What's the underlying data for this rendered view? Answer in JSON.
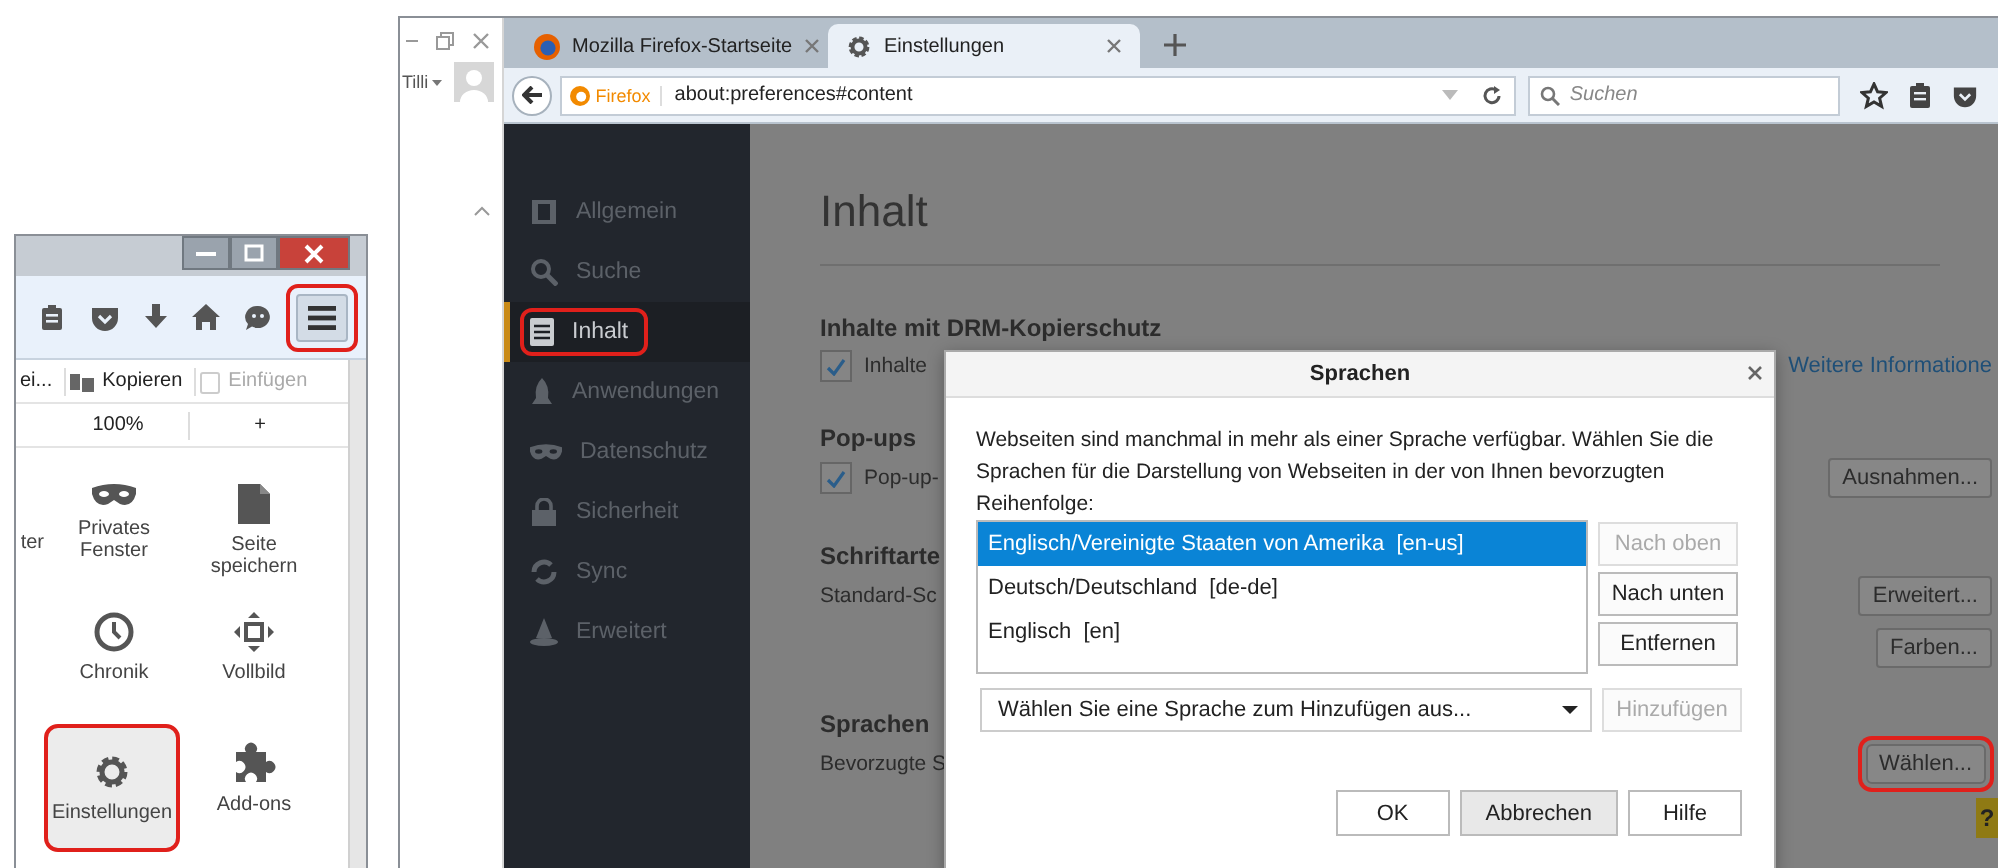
{
  "left_window": {
    "toolbar_icons": [
      {
        "kind": "clipboard",
        "highlighted": false
      },
      {
        "kind": "pocket",
        "highlighted": false
      },
      {
        "kind": "download",
        "highlighted": false
      },
      {
        "kind": "home",
        "highlighted": false
      },
      {
        "kind": "chat",
        "highlighted": false
      },
      {
        "kind": "menu",
        "highlighted": true
      }
    ],
    "edit_row": [
      {
        "label": "ei...",
        "kind": "cut",
        "disabled": false
      },
      {
        "label": "Kopieren",
        "kind": "copy",
        "disabled": false
      },
      {
        "label": "Einfügen",
        "kind": "paste",
        "disabled": true
      }
    ],
    "zoom_row": {
      "value": "100%",
      "increase": "+"
    },
    "menu_items": [
      {
        "label": "ter",
        "kind": "partial",
        "highlighted": false
      },
      {
        "label": "Privates Fenster",
        "kind": "mask",
        "highlighted": false
      },
      {
        "label": "Seite speichern",
        "kind": "page",
        "highlighted": false
      },
      {
        "label": "Chronik",
        "kind": "clock",
        "highlighted": false
      },
      {
        "label": "Vollbild",
        "kind": "fullscreen",
        "highlighted": false
      },
      {
        "label": "Einstellungen",
        "kind": "gear",
        "highlighted": true
      },
      {
        "label": "Add-ons",
        "kind": "puzzle",
        "highlighted": false
      }
    ]
  },
  "browser": {
    "profile": {
      "name": "Tilli"
    },
    "tabs": [
      {
        "title": "Mozilla Firefox-Startseite",
        "kind": "firefox",
        "selected": false
      },
      {
        "title": "Einstellungen",
        "kind": "gear",
        "selected": true
      }
    ],
    "address_bar": {
      "identity": "Firefox",
      "url": "about:preferences#content"
    },
    "search": {
      "placeholder": "Suchen"
    },
    "sidebar": [
      {
        "label": "Allgemein",
        "kind": "general",
        "selected": false,
        "highlighted": false
      },
      {
        "label": "Suche",
        "kind": "search",
        "selected": false,
        "highlighted": false
      },
      {
        "label": "Inhalt",
        "kind": "content",
        "selected": true,
        "highlighted": true
      },
      {
        "label": "Anwendungen",
        "kind": "rocket",
        "selected": false,
        "highlighted": false
      },
      {
        "label": "Datenschutz",
        "kind": "mask",
        "selected": false,
        "highlighted": false
      },
      {
        "label": "Sicherheit",
        "kind": "lock",
        "selected": false,
        "highlighted": false
      },
      {
        "label": "Sync",
        "kind": "sync",
        "selected": false,
        "highlighted": false
      },
      {
        "label": "Erweitert",
        "kind": "wizard",
        "selected": false,
        "highlighted": false
      }
    ],
    "content": {
      "title": "Inhalt",
      "drm": {
        "heading": "Inhalte mit DRM-Kopierschutz",
        "checkbox": {
          "label": "Inhalte",
          "checked": true
        },
        "link": "Weitere Informatione"
      },
      "popups": {
        "heading": "Pop-ups",
        "checkbox": {
          "label": "Pop-up-",
          "checked": true
        },
        "button": {
          "label": "Ausnahmen...",
          "highlighted": false
        }
      },
      "fonts": {
        "heading": "Schriftarte",
        "label": "Standard-Sc",
        "buttons": [
          {
            "label": "Erweitert...",
            "highlighted": false
          },
          {
            "label": "Farben...",
            "highlighted": false
          }
        ]
      },
      "languages": {
        "heading": "Sprachen",
        "label": "Bevorzugte S",
        "button": {
          "label": "Wählen...",
          "highlighted": true
        }
      },
      "help_badge": "?"
    },
    "dialog": {
      "title": "Sprachen",
      "description": "Webseiten sind manchmal in mehr als einer Sprache verfügbar. Wählen Sie die Sprachen für die Darstellung von Webseiten in der von Ihnen bevorzugten Reihenfolge:",
      "languages": [
        {
          "label": "Englisch/Vereinigte Staaten von Amerika  [en-us]",
          "selected": true
        },
        {
          "label": "Deutsch/Deutschland  [de-de]",
          "selected": false
        },
        {
          "label": "Englisch  [en]",
          "selected": false
        }
      ],
      "side_buttons": [
        {
          "label": "Nach oben",
          "disabled": true
        },
        {
          "label": "Nach unten",
          "disabled": false
        },
        {
          "label": "Entfernen",
          "disabled": false
        }
      ],
      "dropdown": {
        "value": "Wählen Sie eine Sprache zum Hinzufügen aus..."
      },
      "add_button": {
        "label": "Hinzufügen",
        "disabled": true
      },
      "footer_buttons": [
        {
          "label": "OK",
          "pressed": false
        },
        {
          "label": "Abbrechen",
          "pressed": true
        },
        {
          "label": "Hilfe",
          "pressed": false
        }
      ]
    }
  }
}
